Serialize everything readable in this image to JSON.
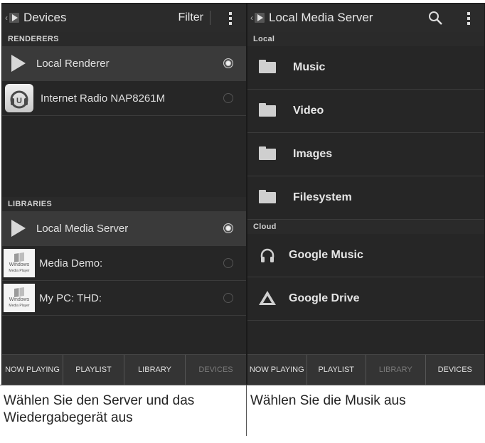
{
  "left": {
    "title": "Devices",
    "filter_label": "Filter",
    "renderers_header": "RENDERERS",
    "renderers": [
      {
        "label": "Local Renderer",
        "selected": true
      },
      {
        "label": "Internet Radio NAP8261M",
        "selected": false
      }
    ],
    "libraries_header": "LIBRARIES",
    "libraries": [
      {
        "label": "Local Media Server",
        "selected": true
      },
      {
        "label": "Media Demo:",
        "selected": false
      },
      {
        "label": "My PC:  THD:",
        "selected": false
      }
    ],
    "win_icon_text": "Windows",
    "win_icon_sub": "Media Player",
    "tabs": [
      "NOW PLAYING",
      "PLAYLIST",
      "LIBRARY",
      "DEVICES"
    ]
  },
  "right": {
    "title": "Local Media Server",
    "local_header": "Local",
    "folders": [
      "Music",
      "Video",
      "Images",
      "Filesystem"
    ],
    "cloud_header": "Cloud",
    "cloud": [
      "Google Music",
      "Google Drive"
    ],
    "tabs": [
      "NOW PLAYING",
      "PLAYLIST",
      "LIBRARY",
      "DEVICES"
    ]
  },
  "captions": {
    "left": "Wählen Sie den Server und das Wiedergabegerät aus",
    "right": "Wählen Sie die Musik aus"
  }
}
